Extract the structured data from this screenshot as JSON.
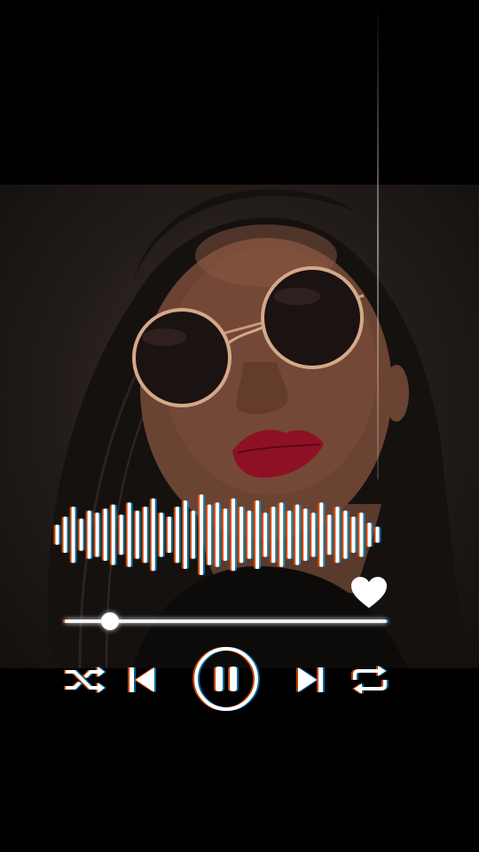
{
  "player": {
    "state": "playing",
    "progress": 0.14,
    "liked": true
  },
  "controls": {
    "shuffle_icon": "shuffle-icon",
    "previous_icon": "skip-previous-icon",
    "play_pause_icon": "pause-icon",
    "next_icon": "skip-next-icon",
    "repeat_icon": "repeat-icon",
    "like_icon": "heart-icon"
  },
  "colors": {
    "background": "#000000",
    "foreground": "#ffffff",
    "glow_warm": "#ff5a00",
    "glow_cool": "#00aaff",
    "lips": "#8e1024"
  },
  "waveform": {
    "levels": [
      0.25,
      0.45,
      0.7,
      0.4,
      0.6,
      0.55,
      0.65,
      0.75,
      0.5,
      0.8,
      0.6,
      0.7,
      0.9,
      0.55,
      0.45,
      0.7,
      0.85,
      0.6,
      1.0,
      0.75,
      0.8,
      0.65,
      0.9,
      0.7,
      0.6,
      0.85,
      0.55,
      0.7,
      0.8,
      0.6,
      0.75,
      0.65,
      0.55,
      0.8,
      0.5,
      0.7,
      0.6,
      0.45,
      0.55,
      0.3,
      0.2
    ]
  }
}
